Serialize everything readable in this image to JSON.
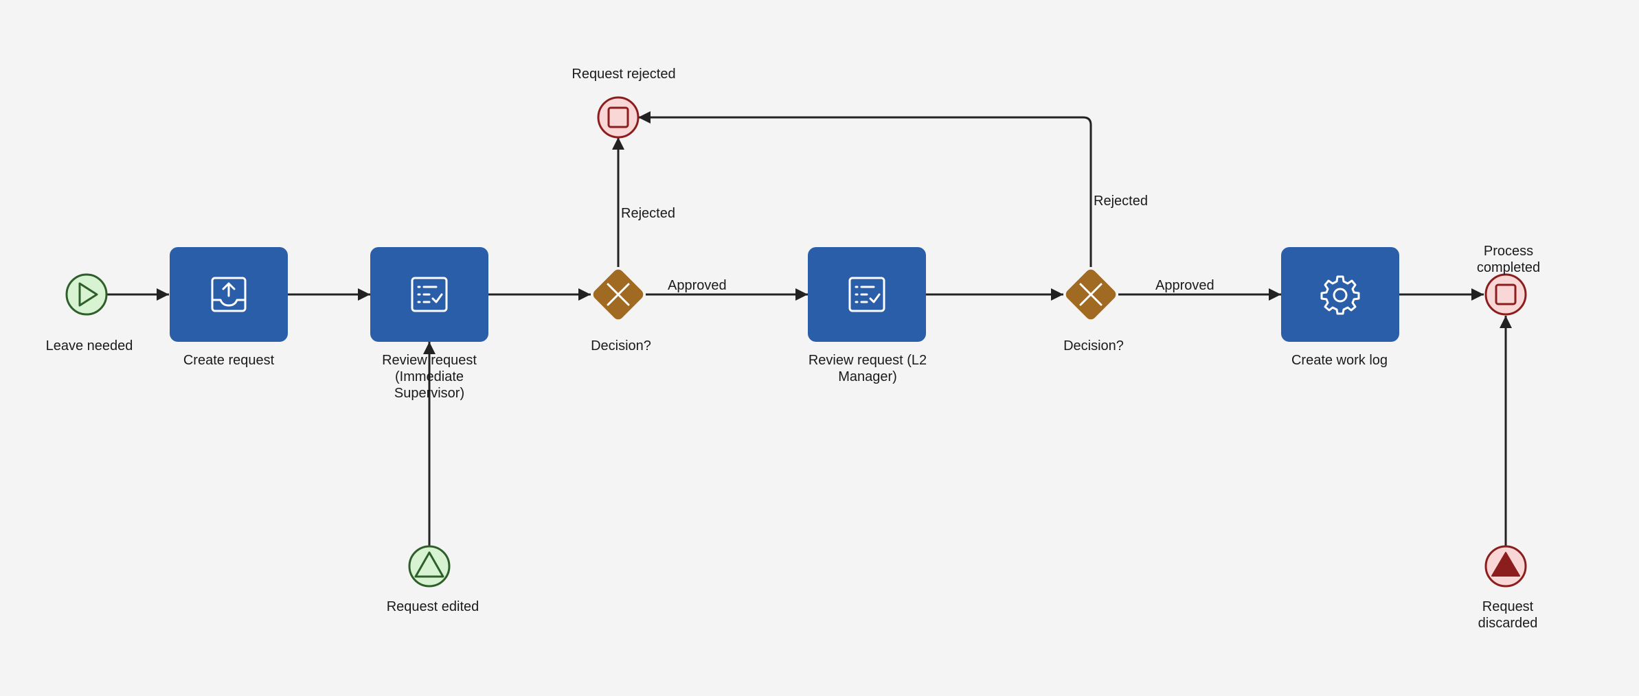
{
  "diagram": {
    "events": {
      "start_leave": "Leave needed",
      "start_edited": "Request edited",
      "end_rejected": "Request rejected",
      "end_completed": "Process completed",
      "end_discarded": "Request discarded"
    },
    "tasks": {
      "create_request": "Create request",
      "review_supervisor": "Review request (Immediate Supervisor)",
      "review_l2": "Review request (L2 Manager)",
      "create_worklog": "Create work log"
    },
    "gateways": {
      "decision_1": "Decision?",
      "decision_2": "Decision?"
    },
    "flows": {
      "rejected_1": "Rejected",
      "approved_1": "Approved",
      "rejected_2": "Rejected",
      "approved_2": "Approved"
    },
    "icons": {
      "create_request": "inbox-upload-icon",
      "review_supervisor": "checklist-icon",
      "review_l2": "checklist-icon",
      "create_worklog": "gear-icon"
    },
    "colors": {
      "task": "#2a5ea8",
      "gateway": "#a06a22",
      "start_fill": "#d7f3d2",
      "start_stroke": "#2e5e2a",
      "end_fill": "#f9d7d7",
      "end_stroke": "#8b1d1d",
      "line": "#222222"
    }
  }
}
